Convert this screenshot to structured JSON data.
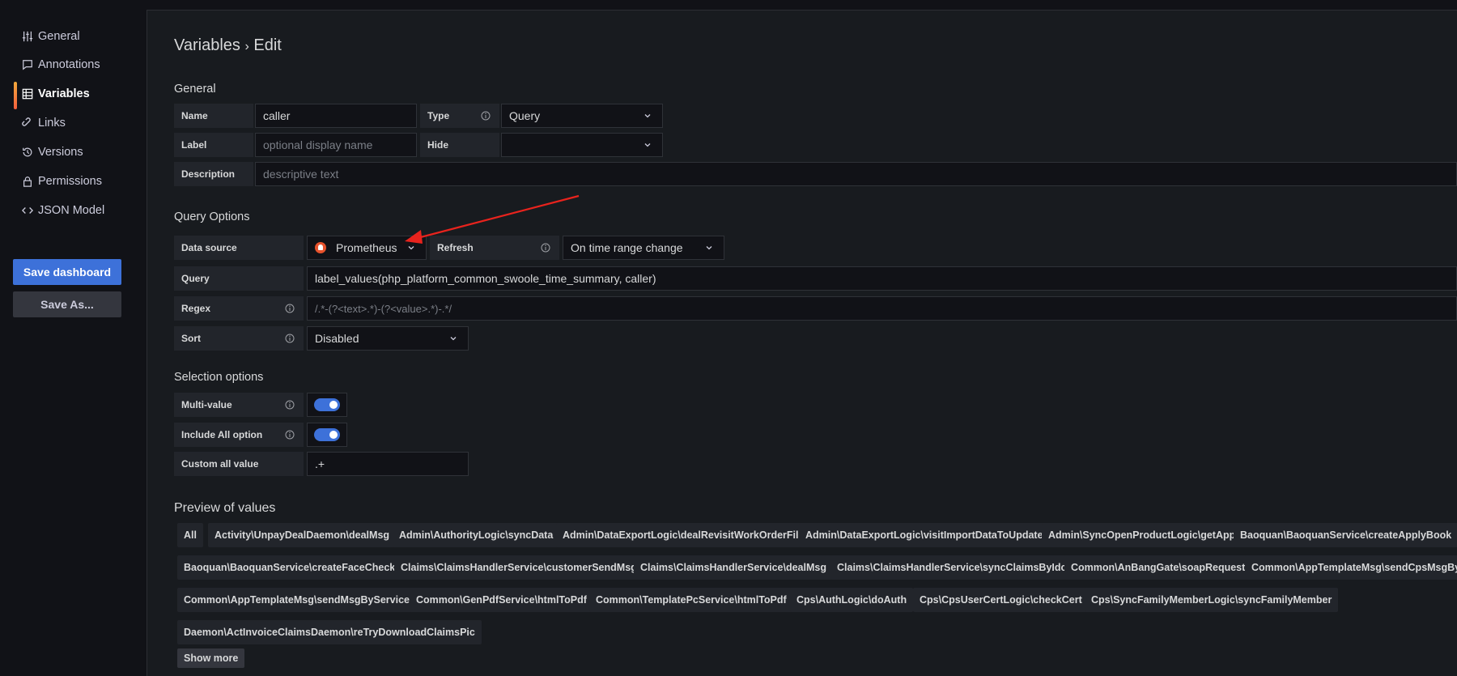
{
  "sidebar": {
    "items": [
      {
        "label": "General",
        "icon": "sliders-icon"
      },
      {
        "label": "Annotations",
        "icon": "comment-icon"
      },
      {
        "label": "Variables",
        "icon": "grid-icon"
      },
      {
        "label": "Links",
        "icon": "link-icon"
      },
      {
        "label": "Versions",
        "icon": "history-icon"
      },
      {
        "label": "Permissions",
        "icon": "lock-icon"
      },
      {
        "label": "JSON Model",
        "icon": "code-icon"
      }
    ],
    "active_item": "Variables",
    "save_button": "Save dashboard",
    "save_as_button": "Save As..."
  },
  "page": {
    "title": "Variables",
    "title_sep": "›",
    "title_sub": "Edit"
  },
  "general": {
    "heading": "General",
    "name_label": "Name",
    "name_value": "caller",
    "type_label": "Type",
    "type_value": "Query",
    "label_label": "Label",
    "label_placeholder": "optional display name",
    "hide_label": "Hide",
    "hide_value": "",
    "description_label": "Description",
    "description_placeholder": "descriptive text"
  },
  "query_options": {
    "heading": "Query Options",
    "datasource_label": "Data source",
    "datasource_value": "Prometheus",
    "refresh_label": "Refresh",
    "refresh_value": "On time range change",
    "query_label": "Query",
    "query_value": "label_values(php_platform_common_swoole_time_summary, caller)",
    "regex_label": "Regex",
    "regex_value": "/.*-(?<text>.*)-(?<value>.*)-.*/",
    "sort_label": "Sort",
    "sort_value": "Disabled"
  },
  "selection_options": {
    "heading": "Selection options",
    "multi_value_label": "Multi-value",
    "multi_value": true,
    "include_all_label": "Include All option",
    "include_all": true,
    "custom_all_label": "Custom all value",
    "custom_all_value": ".+"
  },
  "preview": {
    "heading": "Preview of values",
    "values": [
      "All",
      "Activity\\UnpayDealDaemon\\dealMsg",
      "Admin\\AuthorityLogic\\syncData",
      "Admin\\DataExportLogic\\dealRevisitWorkOrderFile",
      "Admin\\DataExportLogic\\visitImportDataToUpdate",
      "Admin\\SyncOpenProductLogic\\getApp",
      "Baoquan\\BaoquanService\\createApplyBook",
      "Baoquan\\BaoquanService\\createFaceCheck",
      "Claims\\ClaimsHandlerService\\customerSendMsg",
      "Claims\\ClaimsHandlerService\\dealMsg",
      "Claims\\ClaimsHandlerService\\syncClaimsByIdc",
      "Common\\AnBangGate\\soapRequest",
      "Common\\AppTemplateMsg\\sendCpsMsgBySe",
      "Common\\AppTemplateMsg\\sendMsgByService",
      "Common\\GenPdfService\\htmlToPdf",
      "Common\\TemplatePcService\\htmlToPdf",
      "Cps\\AuthLogic\\doAuth",
      "Cps\\CpsUserCertLogic\\checkCert",
      "Cps\\SyncFamilyMemberLogic\\syncFamilyMember",
      "Daemon\\ActInvoiceClaimsDaemon\\reTryDownloadClaimsPic"
    ],
    "show_more": "Show more"
  },
  "colors": {
    "accent": "#3d71d9",
    "annotation_arrow": "#e8231d",
    "active_bar": "#f2a93b"
  }
}
